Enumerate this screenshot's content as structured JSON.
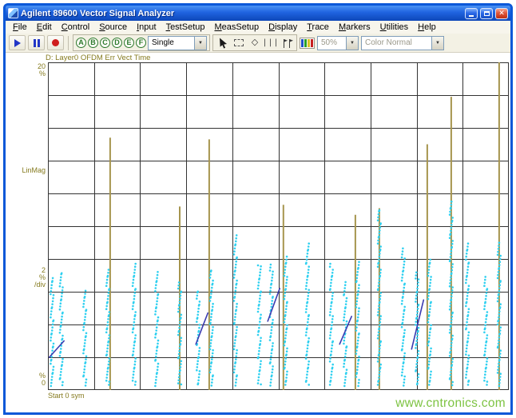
{
  "window": {
    "title": "Agilent 89600 Vector Signal Analyzer"
  },
  "menu": {
    "items": [
      "File",
      "Edit",
      "Control",
      "Source",
      "Input",
      "TestSetup",
      "MeasSetup",
      "Display",
      "Trace",
      "Markers",
      "Utilities",
      "Help"
    ]
  },
  "toolbar": {
    "trace_buttons": [
      "A",
      "B",
      "C",
      "D",
      "E",
      "F"
    ],
    "sweep_mode": "Single",
    "zoom_value": "50%",
    "color_mode": "Color Normal"
  },
  "icons": {
    "close": "✕",
    "dropdown_arrow": "▼",
    "diamond": "◇",
    "bars": "|||"
  },
  "colors": {
    "axis_text": "#857a1e",
    "trace_olive": "#a6954e",
    "trace_cyan": "#2fd0f0",
    "trace_blue": "#3a3ab0",
    "grid": "#333333",
    "watermark": "#7dc342",
    "titlebar_blue": "#1f63e0"
  },
  "watermark": "www.cntronics.com",
  "chart_data": {
    "type": "scatter",
    "title": "D: Layer0 OFDM Err Vect Time",
    "xlabel": "sym",
    "ylabel": "LinMag",
    "x_divisions": 10,
    "y_divisions": 10,
    "ylim": [
      0,
      20
    ],
    "y_per_div": 2,
    "y_unit": "%",
    "grid": true,
    "axis": {
      "y_max": "20",
      "y_max_unit": "%",
      "y_scale": "LinMag",
      "y_div": "2",
      "y_div_unit": "%",
      "y_div_suffix": "/div",
      "y_min": "0",
      "y_min_unit": "%",
      "x_start": "Start 0 sym"
    },
    "series": [
      {
        "name": "error-vector-spikes",
        "style": "vline",
        "color": "#a6954e",
        "points": [
          {
            "x": 1.35,
            "y0": 0,
            "y1": 15.4
          },
          {
            "x": 2.86,
            "y0": 0,
            "y1": 11.2
          },
          {
            "x": 3.5,
            "y0": 0,
            "y1": 15.3
          },
          {
            "x": 5.11,
            "y0": 0,
            "y1": 11.3
          },
          {
            "x": 6.67,
            "y0": 0,
            "y1": 10.7
          },
          {
            "x": 7.19,
            "y0": 0,
            "y1": 11.1
          },
          {
            "x": 8.23,
            "y0": 0,
            "y1": 15.0
          },
          {
            "x": 8.75,
            "y0": 0,
            "y1": 17.9
          },
          {
            "x": 9.79,
            "y0": 0,
            "y1": 20.0
          }
        ]
      },
      {
        "name": "error-vector-scatter",
        "style": "dots",
        "color": "#2fd0f0",
        "points": [
          {
            "x": 0.09,
            "y0": 0.3,
            "y1": 6.9
          },
          {
            "x": 0.29,
            "y0": 0.3,
            "y1": 7.2
          },
          {
            "x": 0.8,
            "y0": 0.3,
            "y1": 6.2
          },
          {
            "x": 1.3,
            "y0": 0.3,
            "y1": 7.4
          },
          {
            "x": 1.87,
            "y0": 0.3,
            "y1": 7.7
          },
          {
            "x": 2.36,
            "y0": 0.3,
            "y1": 7.2
          },
          {
            "x": 2.86,
            "y0": 0.3,
            "y1": 6.6
          },
          {
            "x": 3.26,
            "y0": 0.3,
            "y1": 6.2
          },
          {
            "x": 3.55,
            "y0": 0.3,
            "y1": 7.4
          },
          {
            "x": 4.07,
            "y0": 0.3,
            "y1": 9.5
          },
          {
            "x": 4.59,
            "y0": 0.3,
            "y1": 7.7
          },
          {
            "x": 4.85,
            "y0": 0.3,
            "y1": 7.7
          },
          {
            "x": 5.16,
            "y0": 0.3,
            "y1": 8.2
          },
          {
            "x": 5.63,
            "y0": 0.3,
            "y1": 9.1
          },
          {
            "x": 6.15,
            "y0": 0.3,
            "y1": 7.7
          },
          {
            "x": 6.45,
            "y0": 0.3,
            "y1": 6.7
          },
          {
            "x": 6.72,
            "y0": 0.3,
            "y1": 7.9
          },
          {
            "x": 7.19,
            "y0": 0.3,
            "y1": 11.1
          },
          {
            "x": 7.71,
            "y0": 0.3,
            "y1": 8.7
          },
          {
            "x": 8.01,
            "y0": 0.3,
            "y1": 7.2
          },
          {
            "x": 8.28,
            "y0": 0.3,
            "y1": 8.0
          },
          {
            "x": 8.75,
            "y0": 0.3,
            "y1": 11.6
          },
          {
            "x": 9.1,
            "y0": 0.3,
            "y1": 9.1
          },
          {
            "x": 9.5,
            "y0": 0.3,
            "y1": 7.0
          },
          {
            "x": 9.79,
            "y0": 0.3,
            "y1": 9.1
          }
        ]
      },
      {
        "name": "trend-segments",
        "style": "segment",
        "color": "#3a3ab0",
        "points": [
          {
            "x0": 0.03,
            "y0": 2.0,
            "x1": 0.35,
            "y1": 3.0
          },
          {
            "x0": 3.21,
            "y0": 2.8,
            "x1": 3.47,
            "y1": 4.7
          },
          {
            "x0": 4.77,
            "y0": 4.2,
            "x1": 5.03,
            "y1": 6.2
          },
          {
            "x0": 6.33,
            "y0": 2.8,
            "x1": 6.59,
            "y1": 4.5
          },
          {
            "x0": 7.89,
            "y0": 2.5,
            "x1": 8.15,
            "y1": 5.5
          }
        ]
      }
    ]
  }
}
